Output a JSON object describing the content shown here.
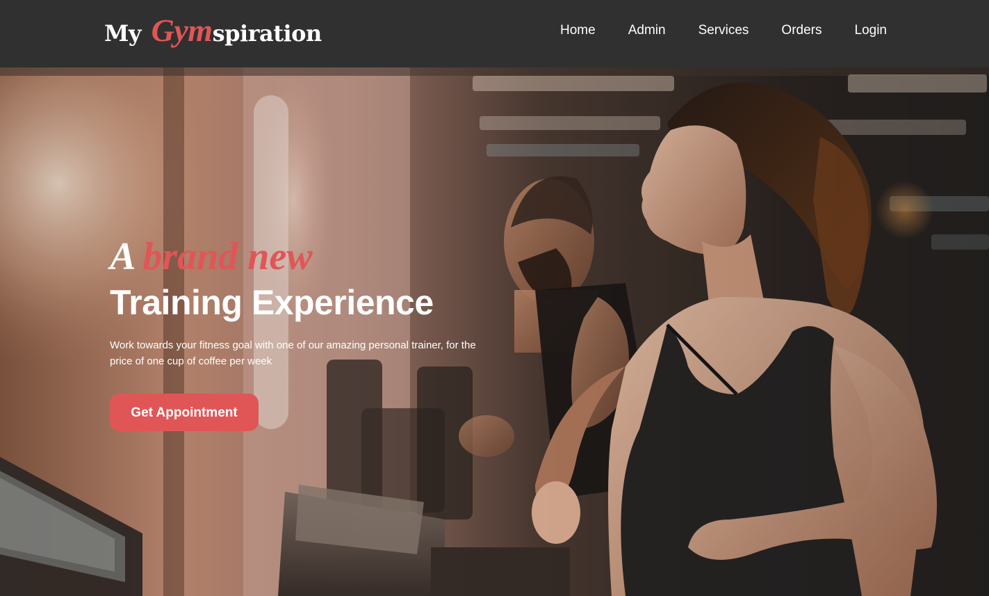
{
  "header": {
    "logo": {
      "prefix": "My ",
      "accent": "Gym",
      "suffix": "spiration"
    },
    "nav": [
      {
        "label": "Home"
      },
      {
        "label": "Admin"
      },
      {
        "label": "Services"
      },
      {
        "label": "Orders"
      },
      {
        "label": "Login"
      }
    ]
  },
  "hero": {
    "kicker_plain": "A",
    "kicker_accent": "brand new",
    "headline": "Training Experience",
    "lead": "Work towards your fitness goal with one of our amazing personal trainer, for the price of one cup of coffee per week",
    "cta_label": "Get Appointment",
    "background_image": "gym-treadmill-photo"
  },
  "colors": {
    "header_bg": "#303030",
    "accent": "#e05656",
    "text": "#ffffff"
  }
}
